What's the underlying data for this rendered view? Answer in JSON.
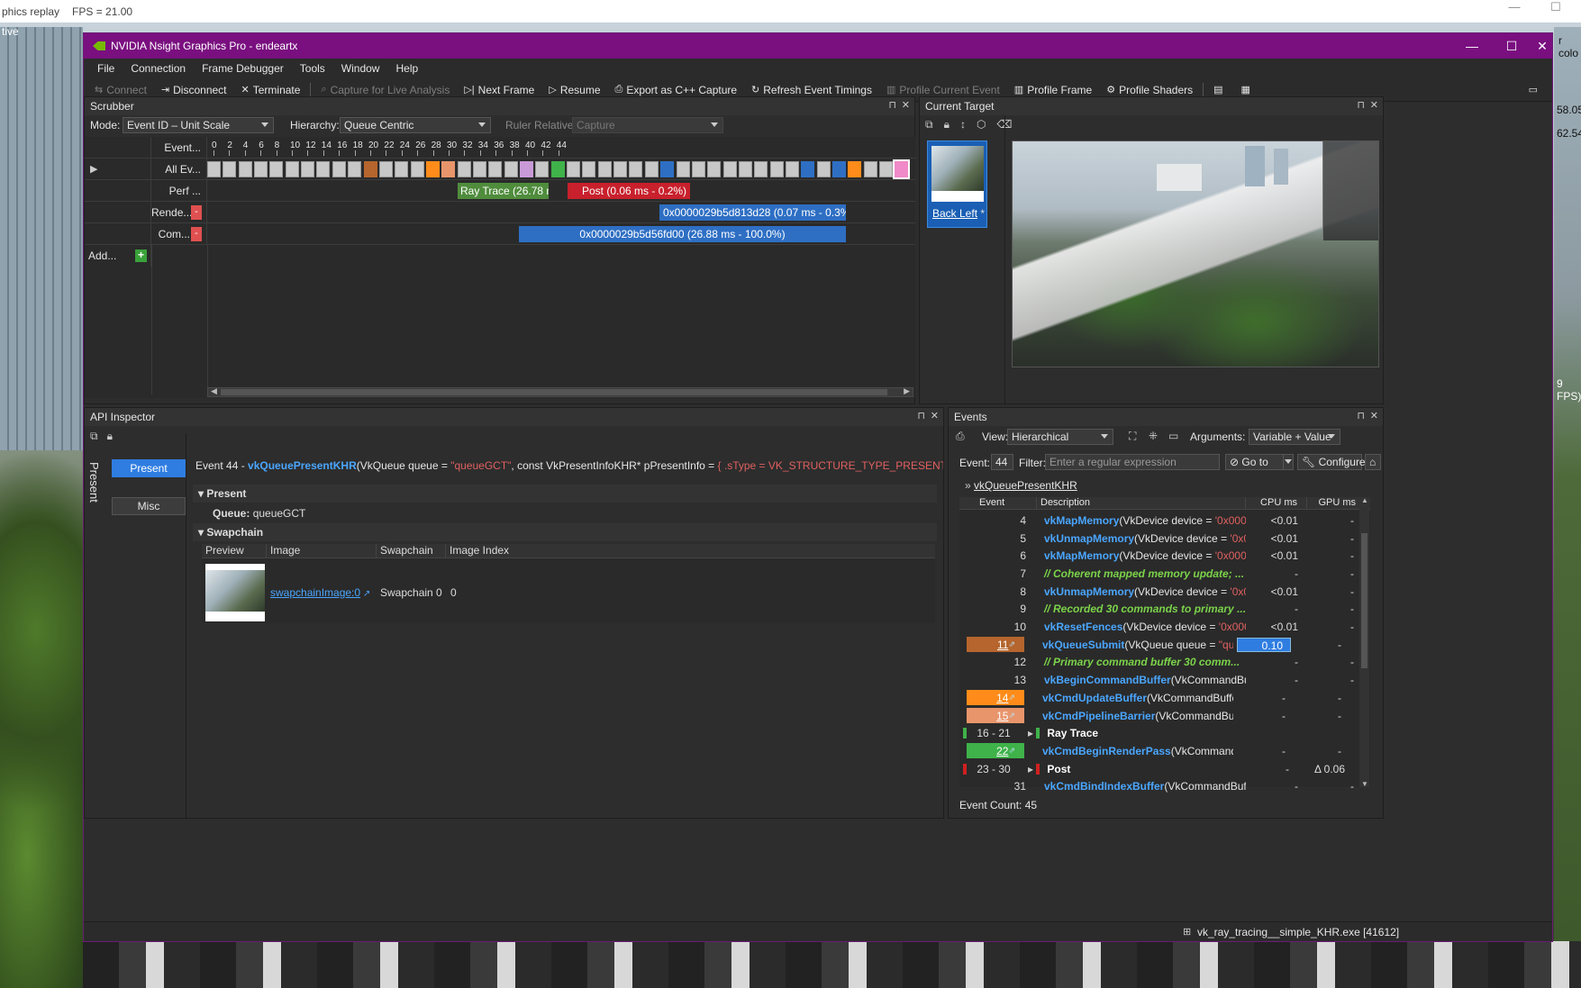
{
  "outer": {
    "title": "phics replay",
    "fps": "FPS = 21.00",
    "left_label": "tive",
    "right_top": "r colo",
    "right_num1": "58.05",
    "right_num2": "62.54",
    "right_fps": "9 FPS)"
  },
  "window": {
    "title": "NVIDIA Nsight Graphics Pro - endeartx",
    "minimize": "—",
    "maximize": "☐",
    "close": "✕"
  },
  "menu": [
    "File",
    "Connection",
    "Frame Debugger",
    "Tools",
    "Window",
    "Help"
  ],
  "toolbar": {
    "connect": "Connect",
    "disconnect": "Disconnect",
    "terminate": "Terminate",
    "capture_live": "Capture for Live Analysis",
    "next_frame": "Next Frame",
    "resume": "Resume",
    "export": "Export as C++ Capture",
    "refresh": "Refresh Event Timings",
    "profile_current": "Profile Current Event",
    "profile_frame": "Profile Frame",
    "profile_shaders": "Profile Shaders"
  },
  "scrubber": {
    "title": "Scrubber",
    "mode_label": "Mode:",
    "mode_value": "Event ID – Unit Scale",
    "hierarchy_label": "Hierarchy:",
    "hierarchy_value": "Queue Centric",
    "ruler_label": "Ruler Relative:",
    "ruler_value": "Capture",
    "rows": [
      "Event...",
      "All Ev...",
      "Perf ...",
      "Rende...",
      "Com..."
    ],
    "add_label": "Add...",
    "ticks": [
      "0",
      "2",
      "4",
      "6",
      "8",
      "10",
      "12",
      "14",
      "16",
      "18",
      "20",
      "22",
      "24",
      "26",
      "28",
      "30",
      "32",
      "34",
      "36",
      "38",
      "40",
      "42",
      "44"
    ],
    "bars": {
      "ray_trace": "Ray Trace (26.78 ms",
      "post": "Post (0.06 ms - 0.2%)",
      "render": "0x0000029b5d813d28 (0.07 ms - 0.3%)",
      "compute": "0x0000029b5d56fd00 (26.88 ms - 100.0%)"
    },
    "cell_colors": {
      "10": "#b5652d",
      "14": "#ff8c1a",
      "15": "#e8956b",
      "20": "#c89ad8",
      "22": "#3fb24a",
      "29": "#2e6fc4",
      "38": "#2e6fc4",
      "40": "#2e6fc4",
      "41": "#ff8c1a",
      "44": "#f08ac8"
    }
  },
  "current_target": {
    "title": "Current Target",
    "thumb_label": "Back Left",
    "thumb_mark": "*"
  },
  "api_inspector": {
    "title": "API Inspector",
    "side_label": "Present",
    "present_btn": "Present",
    "misc_btn": "Misc",
    "event_prefix": "Event 44 -",
    "event_fn": "vkQueuePresentKHR",
    "event_args1": "(VkQueue queue = ",
    "event_q": "\"queueGCT\"",
    "event_args2": ", const VkPresentInfoKHR* pPresentInfo = ",
    "event_info": "{ .sType = VK_STRUCTURE_TYPE_PRESENT_INFO_KHR, .pNe...",
    "section_present": "Present",
    "queue_label": "Queue:",
    "queue_value": "queueGCT",
    "section_swapchain": "Swapchain",
    "sw_headers": [
      "Preview",
      "Image",
      "Swapchain",
      "Image Index"
    ],
    "sw_image": "swapchainImage:0",
    "sw_swapchain": "Swapchain 0",
    "sw_index": "0"
  },
  "events": {
    "title": "Events",
    "view_label": "View:",
    "view_value": "Hierarchical",
    "args_label": "Arguments:",
    "args_value": "Variable + Value",
    "event_label": "Event:",
    "event_value": "44",
    "filter_label": "Filter:",
    "filter_placeholder": "Enter a regular expression",
    "goto": "Go to",
    "configure": "Configure",
    "breadcrumb": "vkQueuePresentKHR",
    "headers": [
      "Event",
      "Description",
      "CPU ms",
      "GPU ms"
    ],
    "count": "Event Count: 45",
    "rows": [
      {
        "ev": "4",
        "fn": "vkMapMemory",
        "rest": "(VkDevice device = ",
        "red": "'0x0000...",
        "cpu": "<0.01",
        "gpu": "-"
      },
      {
        "ev": "5",
        "fn": "vkUnmapMemory",
        "rest": "(VkDevice device = ",
        "red": "'0x00...",
        "cpu": "<0.01",
        "gpu": "-"
      },
      {
        "ev": "6",
        "fn": "vkMapMemory",
        "rest": "(VkDevice device = ",
        "red": "'0x0000...",
        "cpu": "<0.01",
        "gpu": "-"
      },
      {
        "ev": "7",
        "comment": "// Coherent mapped memory update; ...",
        "cpu": "-",
        "gpu": "-"
      },
      {
        "ev": "8",
        "fn": "vkUnmapMemory",
        "rest": "(VkDevice device = ",
        "red": "'0x00...",
        "cpu": "<0.01",
        "gpu": "-"
      },
      {
        "ev": "9",
        "comment": "// Recorded 30 commands to primary ...",
        "cpu": "-",
        "gpu": "-"
      },
      {
        "ev": "10",
        "fn": "vkResetFences",
        "rest": "(VkDevice device = ",
        "red": "'0x0000...",
        "cpu": "<0.01",
        "gpu": "-"
      },
      {
        "ev": "11",
        "fn": "vkQueueSubmit",
        "rest": "(VkQueue queue = ",
        "red": "\"queue...",
        "cpu": "0.10",
        "gpu": "-",
        "color": "#b5652d",
        "cpu_hl": true
      },
      {
        "ev": "12",
        "comment": "// Primary command buffer 30 comm...",
        "cpu": "-",
        "gpu": "-"
      },
      {
        "ev": "13",
        "fn": "vkBeginCommandBuffer",
        "rest": "(VkCommandBu...",
        "cpu": "-",
        "gpu": "-"
      },
      {
        "ev": "14",
        "fn": "vkCmdUpdateBuffer",
        "rest": "(VkCommandBuffer c...",
        "cpu": "-",
        "gpu": "-",
        "color": "#ff8c1a"
      },
      {
        "ev": "15",
        "fn": "vkCmdPipelineBarrier",
        "rest": "(VkCommandBuffe...",
        "cpu": "-",
        "gpu": "-",
        "color": "#e8956b"
      },
      {
        "ev": "16 - 21",
        "group": "Ray Trace",
        "cpu": "",
        "gpu": "",
        "marker": "#3fb24a"
      },
      {
        "ev": "22",
        "fn": "vkCmdBeginRenderPass",
        "rest": "(VkCommandBu...",
        "cpu": "-",
        "gpu": "-",
        "color": "#3fb24a"
      },
      {
        "ev": "23 - 30",
        "group": "Post",
        "cpu": "-",
        "gpu": "Δ 0.06",
        "marker": "#d02020"
      },
      {
        "ev": "31",
        "fn": "vkCmdBindIndexBuffer",
        "rest": "(VkCommandBuff...",
        "cpu": "-",
        "gpu": "-"
      }
    ]
  },
  "status": {
    "process": "vk_ray_tracing__simple_KHR.exe [41612]"
  }
}
